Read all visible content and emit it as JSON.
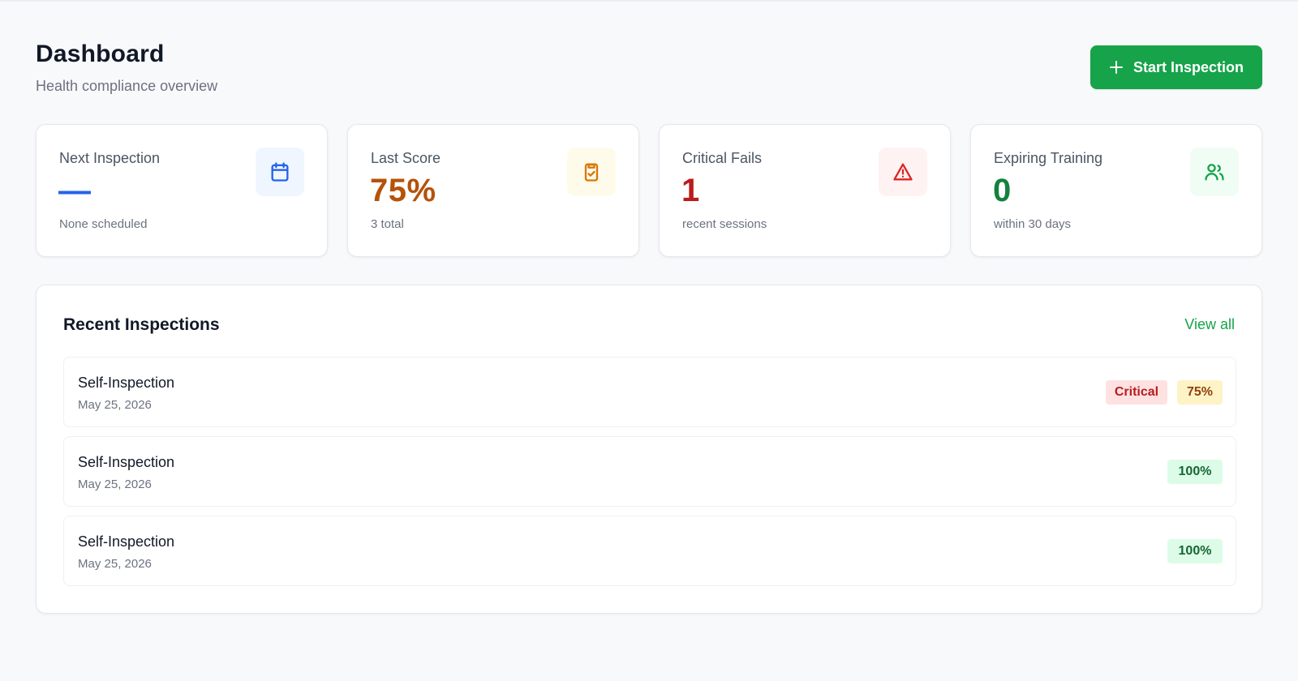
{
  "header": {
    "title": "Dashboard",
    "subtitle": "Health compliance overview",
    "primary_action": {
      "label": "Start Inspection",
      "icon": "plus-icon"
    }
  },
  "stats": [
    {
      "label": "Next Inspection",
      "value": "—",
      "note": "None scheduled",
      "icon": "calendar-icon",
      "value_color": "#2563eb",
      "icon_color": "#2563eb"
    },
    {
      "label": "Last Score",
      "value": "75%",
      "note": "3 total",
      "icon": "clipboard-check-icon",
      "value_color": "#b45309",
      "icon_color": "#d97706"
    },
    {
      "label": "Critical Fails",
      "value": "1",
      "note": "recent sessions",
      "icon": "alert-triangle-icon",
      "value_color": "#b91c1c",
      "icon_color": "#dc2626"
    },
    {
      "label": "Expiring Training",
      "value": "0",
      "note": "within 30 days",
      "icon": "users-icon",
      "value_color": "#15803d",
      "icon_color": "#16a34a"
    }
  ],
  "recent_inspections": {
    "title": "Recent Inspections",
    "view_all_label": "View all",
    "items": [
      {
        "name": "Self-Inspection",
        "date": "May 25, 2026",
        "critical_label": "Critical",
        "score": "75%",
        "score_color": "amber"
      },
      {
        "name": "Self-Inspection",
        "date": "May 25, 2026",
        "score": "100%",
        "score_color": "green"
      },
      {
        "name": "Self-Inspection",
        "date": "May 25, 2026",
        "score": "100%",
        "score_color": "green"
      }
    ]
  }
}
